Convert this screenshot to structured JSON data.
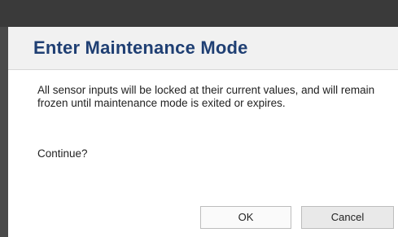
{
  "dialog": {
    "title": "Enter Maintenance Mode",
    "message": "All sensor inputs will be locked at their current values, and will remain frozen until maintenance mode is exited or expires.",
    "prompt": "Continue?",
    "buttons": {
      "ok_label": "OK",
      "cancel_label": "Cancel"
    }
  },
  "colors": {
    "title_text": "#1f3f73",
    "title_bar_bg": "#f1f1f1",
    "background_strip": "#3a3a3a"
  }
}
